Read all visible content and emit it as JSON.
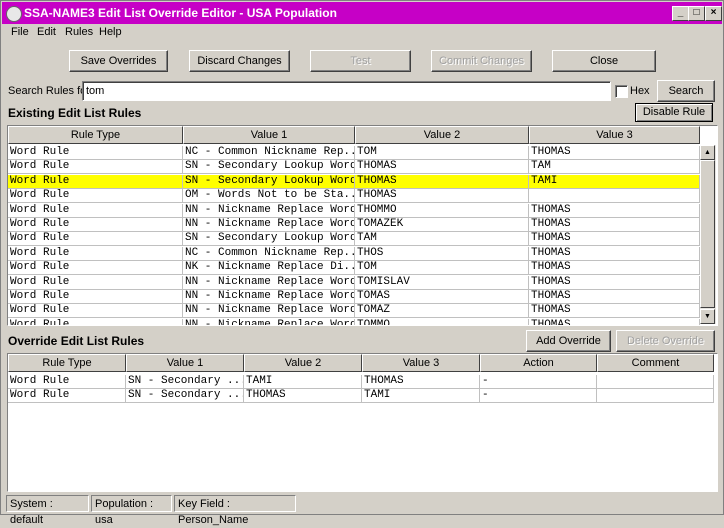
{
  "window": {
    "title": "SSA-NAME3 Edit List Override Editor - USA Population",
    "title_color": "#c600c6",
    "controls": {
      "minimize": "_",
      "maximize": "□",
      "close": "×"
    }
  },
  "menu": [
    "File",
    "Edit",
    "Rules",
    "Help"
  ],
  "toolbar": {
    "save": "Save Overrides",
    "discard": "Discard Changes",
    "test": "Test",
    "commit": "Commit Changes",
    "close": "Close"
  },
  "search": {
    "label": "Search Rules for",
    "value": "tom",
    "hex_label": "Hex",
    "hex_checked": false,
    "button": "Search"
  },
  "existing": {
    "title": "Existing Edit List Rules",
    "disable_button": "Disable Rule",
    "columns": [
      "Rule Type",
      "Value 1",
      "Value 2",
      "Value 3"
    ],
    "selected_index": 2,
    "rows": [
      [
        "Word Rule",
        "NC - Common Nickname Rep...",
        "TOM",
        "THOMAS"
      ],
      [
        "Word Rule",
        "SN - Secondary Lookup Word",
        "THOMAS",
        "TAM"
      ],
      [
        "Word Rule",
        "SN - Secondary Lookup Word",
        "THOMAS",
        "TAMI"
      ],
      [
        "Word Rule",
        "OM - Words Not to be Sta...",
        "THOMAS",
        ""
      ],
      [
        "Word Rule",
        "NN - Nickname Replace Word",
        "THOMMO",
        "THOMAS"
      ],
      [
        "Word Rule",
        "NN - Nickname Replace Word",
        "TOMAZEK",
        "THOMAS"
      ],
      [
        "Word Rule",
        "SN - Secondary Lookup Word",
        "TAM",
        "THOMAS"
      ],
      [
        "Word Rule",
        "NC - Common Nickname Rep...",
        "THOS",
        "THOMAS"
      ],
      [
        "Word Rule",
        "NK - Nickname Replace Di...",
        "TOM",
        "THOMAS"
      ],
      [
        "Word Rule",
        "NN - Nickname Replace Word",
        "TOMISLAV",
        "THOMAS"
      ],
      [
        "Word Rule",
        "NN - Nickname Replace Word",
        "TOMAS",
        "THOMAS"
      ],
      [
        "Word Rule",
        "NN - Nickname Replace Word",
        "TOMAZ",
        "THOMAS"
      ],
      [
        "Word Rule",
        "NN - Nickname Replace Word",
        "TOMMO",
        "THOMAS"
      ]
    ]
  },
  "override": {
    "title": "Override Edit List Rules",
    "add_button": "Add Override",
    "delete_button": "Delete Override",
    "columns": [
      "Rule Type",
      "Value 1",
      "Value 2",
      "Value 3",
      "Action",
      "Comment"
    ],
    "rows": [
      [
        "Word Rule",
        "SN - Secondary ...",
        "TAMI",
        "THOMAS",
        "-",
        ""
      ],
      [
        "Word Rule",
        "SN - Secondary ...",
        "THOMAS",
        "TAMI",
        "-",
        ""
      ]
    ]
  },
  "status": {
    "system": "System : default",
    "population": "Population : usa",
    "key_field": "Key Field : Person_Name"
  }
}
